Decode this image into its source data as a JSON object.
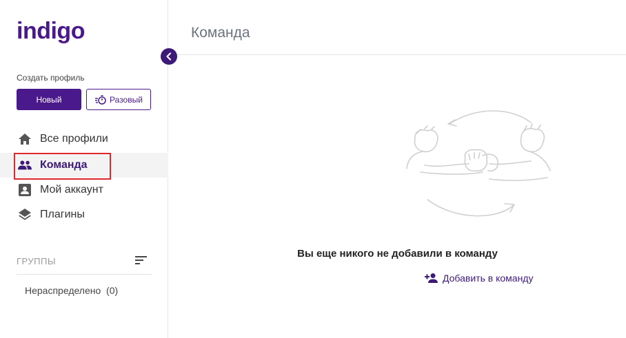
{
  "app": {
    "logo": "indigo"
  },
  "sidebar": {
    "create_label": "Создать профиль",
    "new_button": "Новый",
    "once_button": "Разовый",
    "nav": [
      {
        "label": "Все профили",
        "icon": "home-icon"
      },
      {
        "label": "Команда",
        "icon": "team-icon",
        "active": true
      },
      {
        "label": "Мой аккаунт",
        "icon": "account-icon"
      },
      {
        "label": "Плагины",
        "icon": "layers-icon"
      }
    ],
    "groups_title": "ГРУППЫ",
    "groups": [
      {
        "label": "Нераспределено  (0)"
      }
    ]
  },
  "main": {
    "title": "Команда",
    "empty_text": "Вы еще никого не добавили в команду",
    "add_link": "Добавить в команду"
  },
  "colors": {
    "brand": "#4a1a8c",
    "highlight": "#e0262b",
    "active_bg": "#f3f3f3"
  }
}
